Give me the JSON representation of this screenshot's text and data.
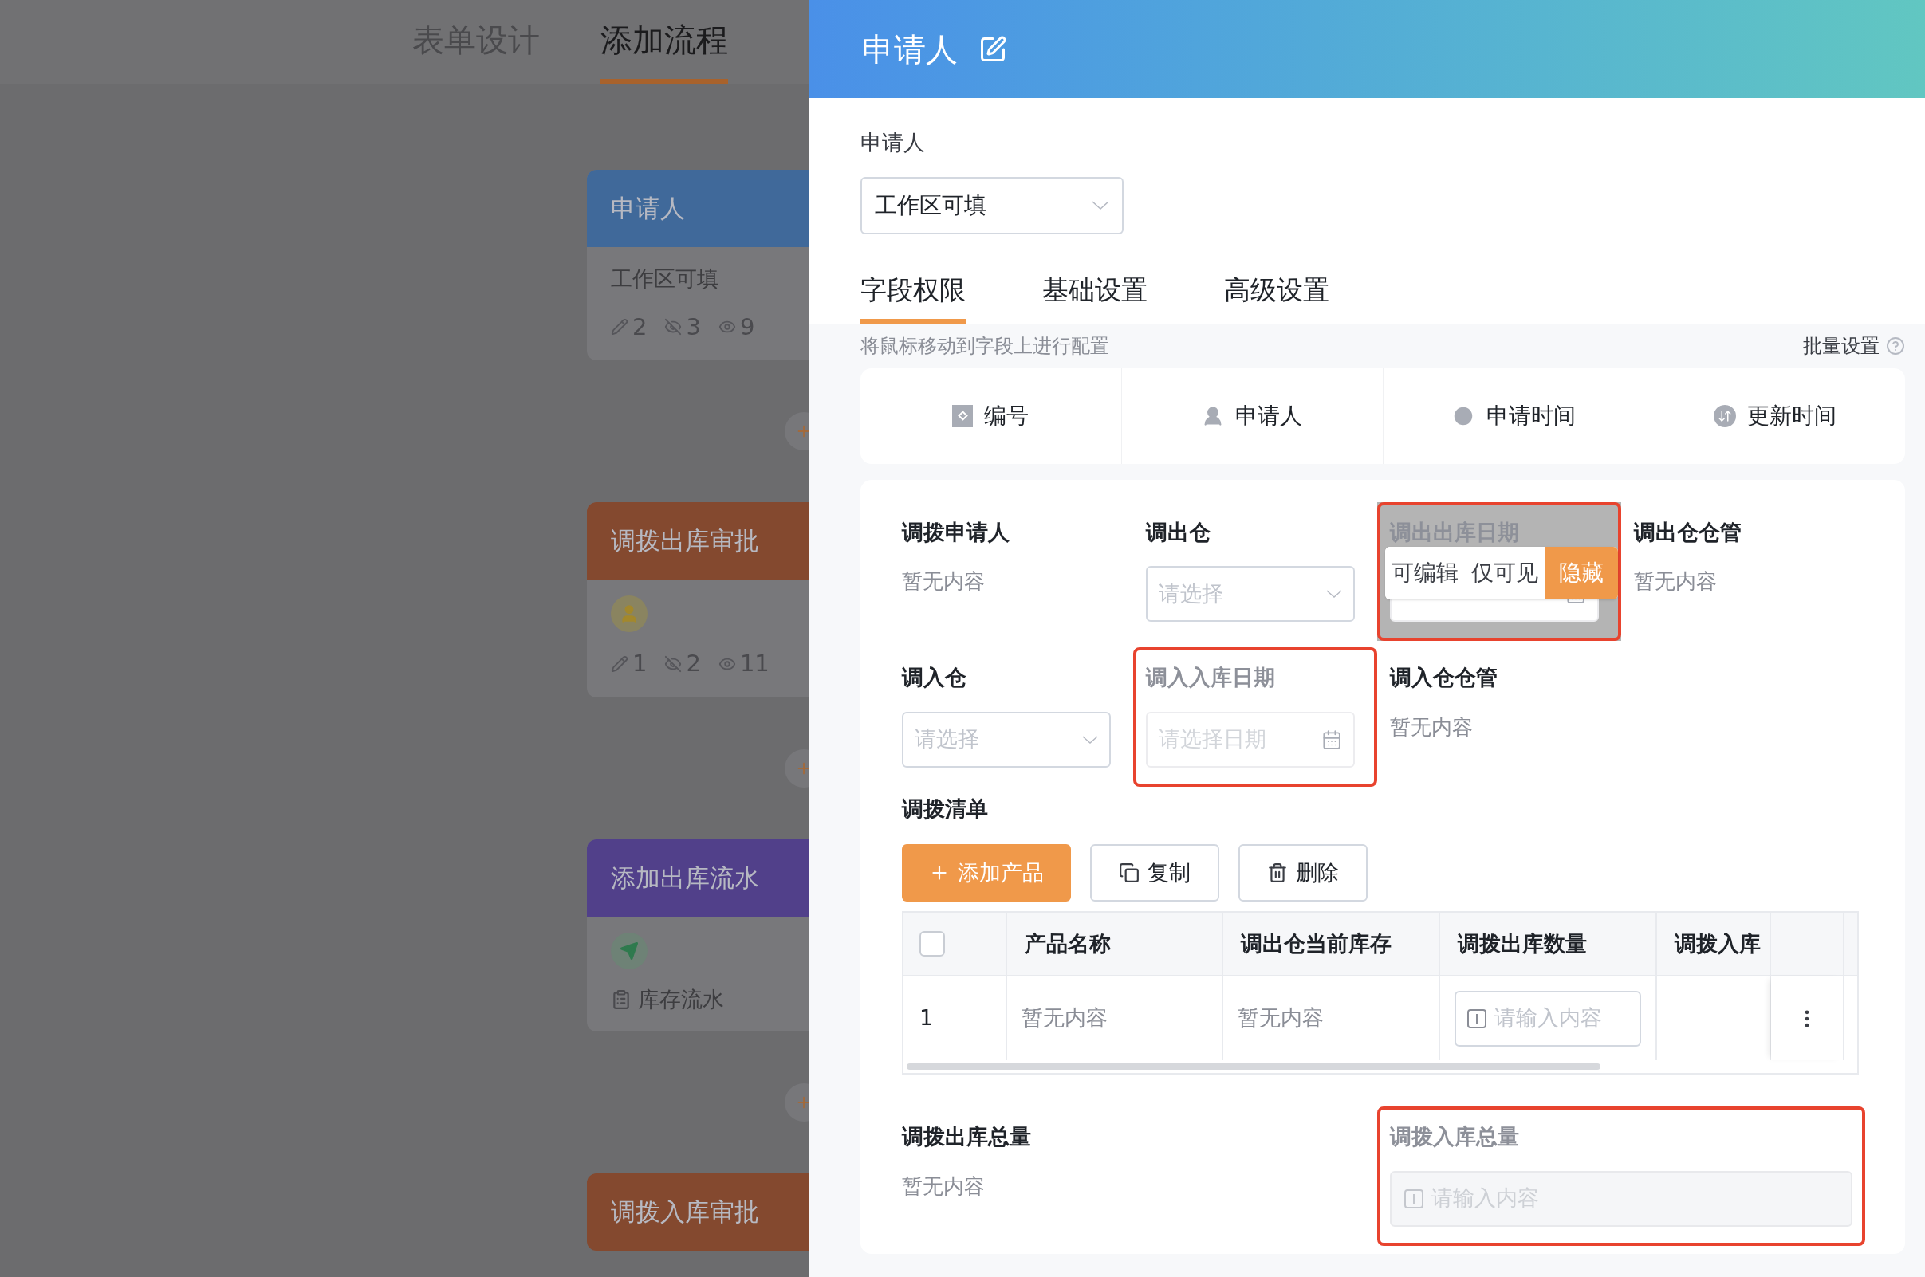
{
  "nav_tabs": [
    {
      "label": "表单设计",
      "selected": false
    },
    {
      "label": "添加流程",
      "selected": true
    }
  ],
  "flow_nodes": [
    {
      "title": "申请人",
      "color": "#40699a",
      "kind": "stats",
      "subtitle": "工作区可填",
      "stats": [
        "2",
        "3",
        "9"
      ]
    },
    {
      "title": "调拨出库审批",
      "color": "#84492f",
      "kind": "approver",
      "stats": [
        "1",
        "2",
        "11"
      ]
    },
    {
      "title": "添加出库流水",
      "color": "#51408a",
      "kind": "action",
      "subtitle": "库存流水"
    },
    {
      "title": "调拨入库审批",
      "color": "#84492f",
      "kind": "plain"
    }
  ],
  "drawer": {
    "title": "申请人",
    "permission_label": "申请人",
    "permission_value": "工作区可填",
    "tabs": [
      {
        "label": "字段权限",
        "selected": true
      },
      {
        "label": "基础设置",
        "selected": false
      },
      {
        "label": "高级设置",
        "selected": false
      }
    ],
    "hint": "将鼠标移动到字段上进行配置",
    "batch_label": "批量设置",
    "system_fields": [
      {
        "label": "编号",
        "kind": "number"
      },
      {
        "label": "申请人",
        "kind": "user"
      },
      {
        "label": "申请时间",
        "kind": "time"
      },
      {
        "label": "更新时间",
        "kind": "update"
      }
    ],
    "field_rows": [
      [
        {
          "label": "调拨申请人",
          "kind": "text",
          "value": "暂无内容",
          "hidden": false
        },
        {
          "label": "调出仓",
          "kind": "select",
          "placeholder": "请选择",
          "hidden": false
        },
        {
          "label": "调出出库日期",
          "kind": "date",
          "hidden": true,
          "menu": [
            {
              "label": "可编辑",
              "selected": false
            },
            {
              "label": "仅可见",
              "selected": false
            },
            {
              "label": "隐藏",
              "selected": true
            }
          ]
        },
        {
          "label": "调出仓仓管",
          "kind": "text",
          "value": "暂无内容",
          "hidden": false
        }
      ],
      [
        {
          "label": "调入仓",
          "kind": "select",
          "placeholder": "请选择",
          "hidden": false
        },
        {
          "label": "调入入库日期",
          "kind": "date",
          "placeholder": "请选择日期",
          "hidden": true
        },
        {
          "label": "调入仓仓管",
          "kind": "text",
          "value": "暂无内容",
          "hidden": false
        }
      ]
    ],
    "detail": {
      "label": "调拨清单",
      "buttons": [
        {
          "label": "添加产品",
          "kind": "primary"
        },
        {
          "label": "复制",
          "kind": "copy"
        },
        {
          "label": "删除",
          "kind": "delete"
        }
      ],
      "select_all_checked": false,
      "columns": [
        "产品名称",
        "调出仓当前库存",
        "调拨出库数量",
        "调拨入库"
      ],
      "rows": [
        {
          "index": "1",
          "cells": [
            {
              "kind": "text",
              "text": "暂无内容"
            },
            {
              "kind": "text",
              "text": "暂无内容"
            },
            {
              "kind": "input",
              "placeholder": "请输入内容"
            },
            {
              "kind": "blank"
            }
          ]
        }
      ]
    },
    "summary_fields": [
      {
        "label": "调拨出库总量",
        "kind": "text",
        "value": "暂无内容",
        "hidden": false
      },
      {
        "label": "调拨入库总量",
        "kind": "number",
        "placeholder": "请输入内容",
        "hidden": true
      }
    ]
  }
}
